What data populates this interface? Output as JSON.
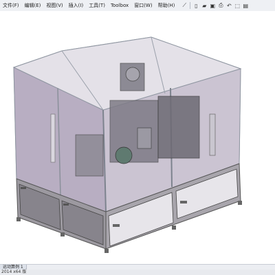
{
  "menu": {
    "items": [
      {
        "label": "文件(F)"
      },
      {
        "label": "编辑(E)"
      },
      {
        "label": "视图(V)"
      },
      {
        "label": "插入(I)"
      },
      {
        "label": "工具(T)"
      },
      {
        "label": "Toolbox"
      },
      {
        "label": "窗口(W)"
      },
      {
        "label": "帮助(H)"
      }
    ]
  },
  "toolbar": {
    "icons": [
      "pin-icon",
      "new-document-icon",
      "open-folder-icon",
      "save-icon",
      "print-icon",
      "undo-icon",
      "select-arrow-icon",
      "rebuild-icon"
    ]
  },
  "tabs": [
    {
      "label": "运动算例 1"
    }
  ],
  "status": {
    "text": "2014 x64 版"
  },
  "colors": {
    "glass": "#b7aec0",
    "frame": "#c9ccd3",
    "base_panel": "#8f8c92",
    "background": "#ffffff"
  }
}
